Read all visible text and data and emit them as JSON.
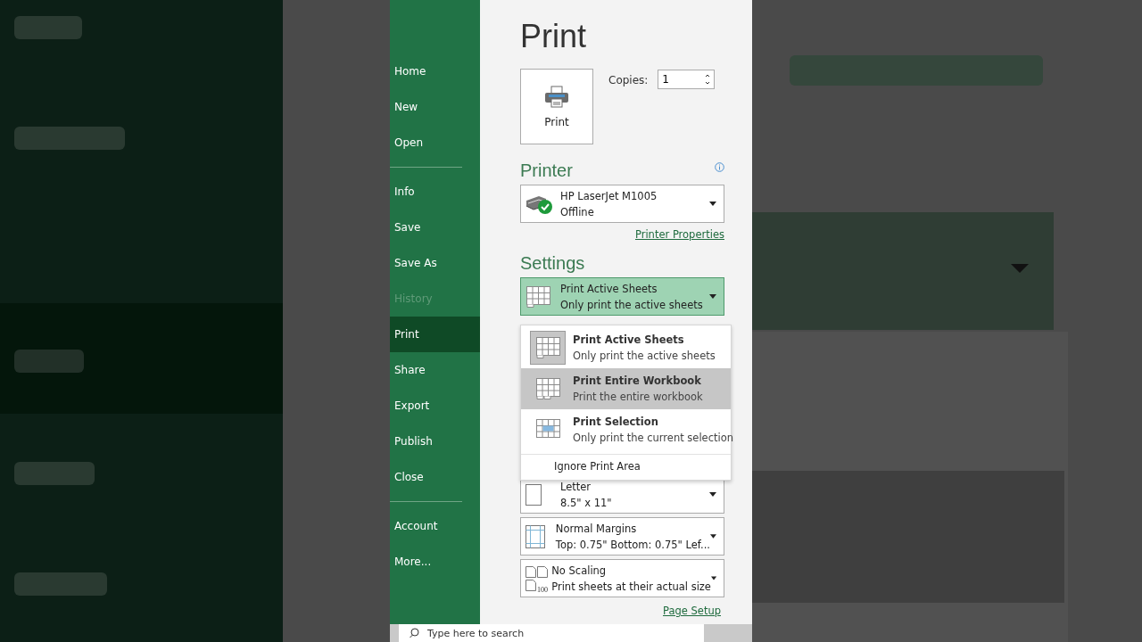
{
  "sidebar": {
    "groups": [
      [
        {
          "label": "Home",
          "selected": false,
          "disabled": false
        },
        {
          "label": "New",
          "selected": false,
          "disabled": false
        },
        {
          "label": "Open",
          "selected": false,
          "disabled": false
        }
      ],
      [
        {
          "label": "Info",
          "selected": false,
          "disabled": false
        },
        {
          "label": "Save",
          "selected": false,
          "disabled": false
        },
        {
          "label": "Save As",
          "selected": false,
          "disabled": false
        },
        {
          "label": "History",
          "selected": false,
          "disabled": true
        },
        {
          "label": "Print",
          "selected": true,
          "disabled": false
        },
        {
          "label": "Share",
          "selected": false,
          "disabled": false
        },
        {
          "label": "Export",
          "selected": false,
          "disabled": false
        },
        {
          "label": "Publish",
          "selected": false,
          "disabled": false
        },
        {
          "label": "Close",
          "selected": false,
          "disabled": false
        }
      ],
      [
        {
          "label": "Account",
          "selected": false,
          "disabled": false
        },
        {
          "label": "More...",
          "selected": false,
          "disabled": false
        }
      ]
    ]
  },
  "title": "Print",
  "print_button": {
    "label": "Print"
  },
  "copies": {
    "label": "Copies:",
    "value": "1"
  },
  "printer": {
    "heading": "Printer",
    "name": "HP LaserJet M1005",
    "status": "Offline",
    "link": "Printer Properties"
  },
  "settings": {
    "heading": "Settings",
    "active": {
      "kind": "sheets",
      "title": "Print Active Sheets",
      "subtitle": "Only print the active sheets",
      "open": true
    },
    "menu": [
      {
        "kind": "sheets",
        "title": "Print Active Sheets",
        "subtitle": "Only print the active sheets",
        "selected": true,
        "hovered": false
      },
      {
        "kind": "workbook",
        "title": "Print Entire Workbook",
        "subtitle": "Print the entire workbook",
        "selected": false,
        "hovered": true
      },
      {
        "kind": "selection",
        "title": "Print Selection",
        "subtitle": "Only print the current selection",
        "selected": false,
        "hovered": false
      },
      {
        "kind": "plain",
        "title": "Ignore Print Area",
        "hovered": false
      }
    ],
    "dropdowns": [
      {
        "kind": "paper",
        "title": "Letter",
        "subtitle": "8.5\" x 11\""
      },
      {
        "kind": "margins",
        "title": "Normal Margins",
        "subtitle": "Top: 0.75\" Bottom: 0.75\" Lef..."
      },
      {
        "kind": "scaling",
        "title": "No Scaling",
        "subtitle": "Print sheets at their actual size",
        "icon_label": "100"
      }
    ],
    "link": "Page Setup"
  },
  "taskbar": {
    "search_placeholder": "Type here to search"
  }
}
